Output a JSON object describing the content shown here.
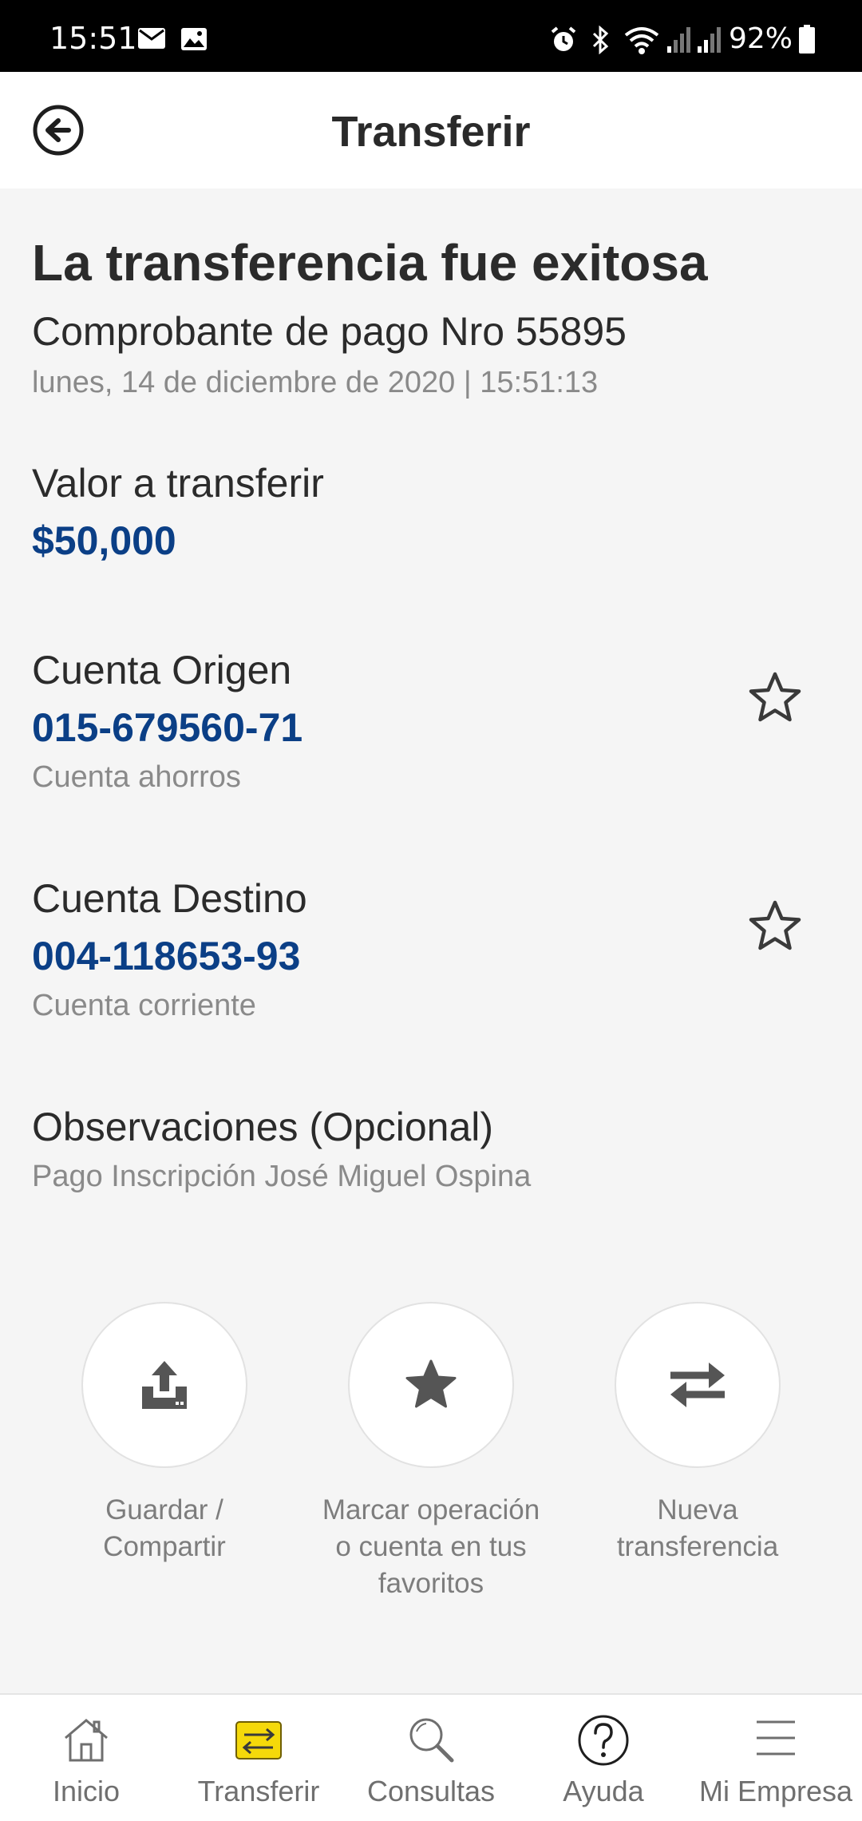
{
  "status_bar": {
    "time": "15:51",
    "battery": "92%",
    "left_icons": [
      "mail-icon",
      "image-icon"
    ],
    "right_icons": [
      "alarm-icon",
      "bluetooth-icon",
      "wifi-icon",
      "signal-icon",
      "signal-icon",
      "battery-icon"
    ]
  },
  "header": {
    "title": "Transferir",
    "back_icon": "back-arrow-icon"
  },
  "summary": {
    "headline": "La transferencia fue exitosa",
    "receipt": "Comprobante de pago Nro  55895",
    "datetime": "lunes, 14 de diciembre de 2020 | 15:51:13"
  },
  "amount": {
    "label": "Valor a transferir",
    "value": "$50,000"
  },
  "origin": {
    "label": "Cuenta Origen",
    "number": "015-679560-71",
    "type": "Cuenta ahorros"
  },
  "destination": {
    "label": "Cuenta Destino",
    "number": "004-118653-93",
    "type": "Cuenta corriente"
  },
  "notes": {
    "label": "Observaciones (Opcional)",
    "value": "Pago Inscripción José Miguel Ospina"
  },
  "actions": [
    {
      "line1": "Guardar /",
      "line2": "Compartir",
      "line3": "",
      "icon": "upload-icon"
    },
    {
      "line1": "Marcar operación",
      "line2": "o cuenta en tus",
      "line3": "favoritos",
      "icon": "star-icon"
    },
    {
      "line1": "Nueva",
      "line2": "transferencia",
      "line3": "",
      "icon": "swap-arrows-icon"
    }
  ],
  "bottom_nav": [
    {
      "label": "Inicio",
      "icon": "home-icon"
    },
    {
      "label": "Transferir",
      "icon": "transfer-icon",
      "active": true
    },
    {
      "label": "Consultas",
      "icon": "search-icon"
    },
    {
      "label": "Ayuda",
      "icon": "help-icon"
    },
    {
      "label": "Mi Empresa",
      "icon": "menu-icon"
    }
  ],
  "colors": {
    "accent_blue": "#0b3f86",
    "active_yellow": "#f5d90a",
    "icon_gray": "#555555"
  }
}
